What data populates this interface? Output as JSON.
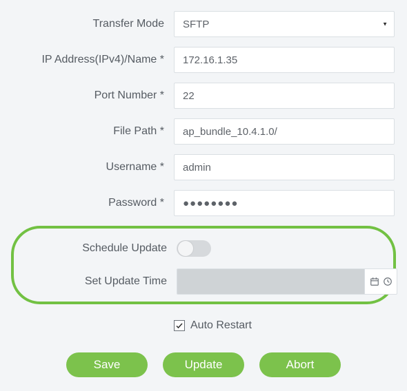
{
  "fields": {
    "transferMode": {
      "label": "Transfer Mode",
      "value": "SFTP",
      "options": [
        "SFTP"
      ]
    },
    "ip": {
      "label": "IP Address(IPv4)/Name *",
      "value": "172.16.1.35"
    },
    "port": {
      "label": "Port Number *",
      "value": "22"
    },
    "filePath": {
      "label": "File Path *",
      "value": "ap_bundle_10.4.1.0/"
    },
    "username": {
      "label": "Username *",
      "value": "admin"
    },
    "password": {
      "label": "Password *",
      "masked": "●●●●●●●●"
    },
    "scheduleUpdate": {
      "label": "Schedule Update",
      "on": false
    },
    "setUpdateTime": {
      "label": "Set Update Time",
      "value": ""
    },
    "autoRestart": {
      "label": "Auto Restart",
      "checked": true
    }
  },
  "buttons": {
    "save": "Save",
    "update": "Update",
    "abort": "Abort"
  }
}
